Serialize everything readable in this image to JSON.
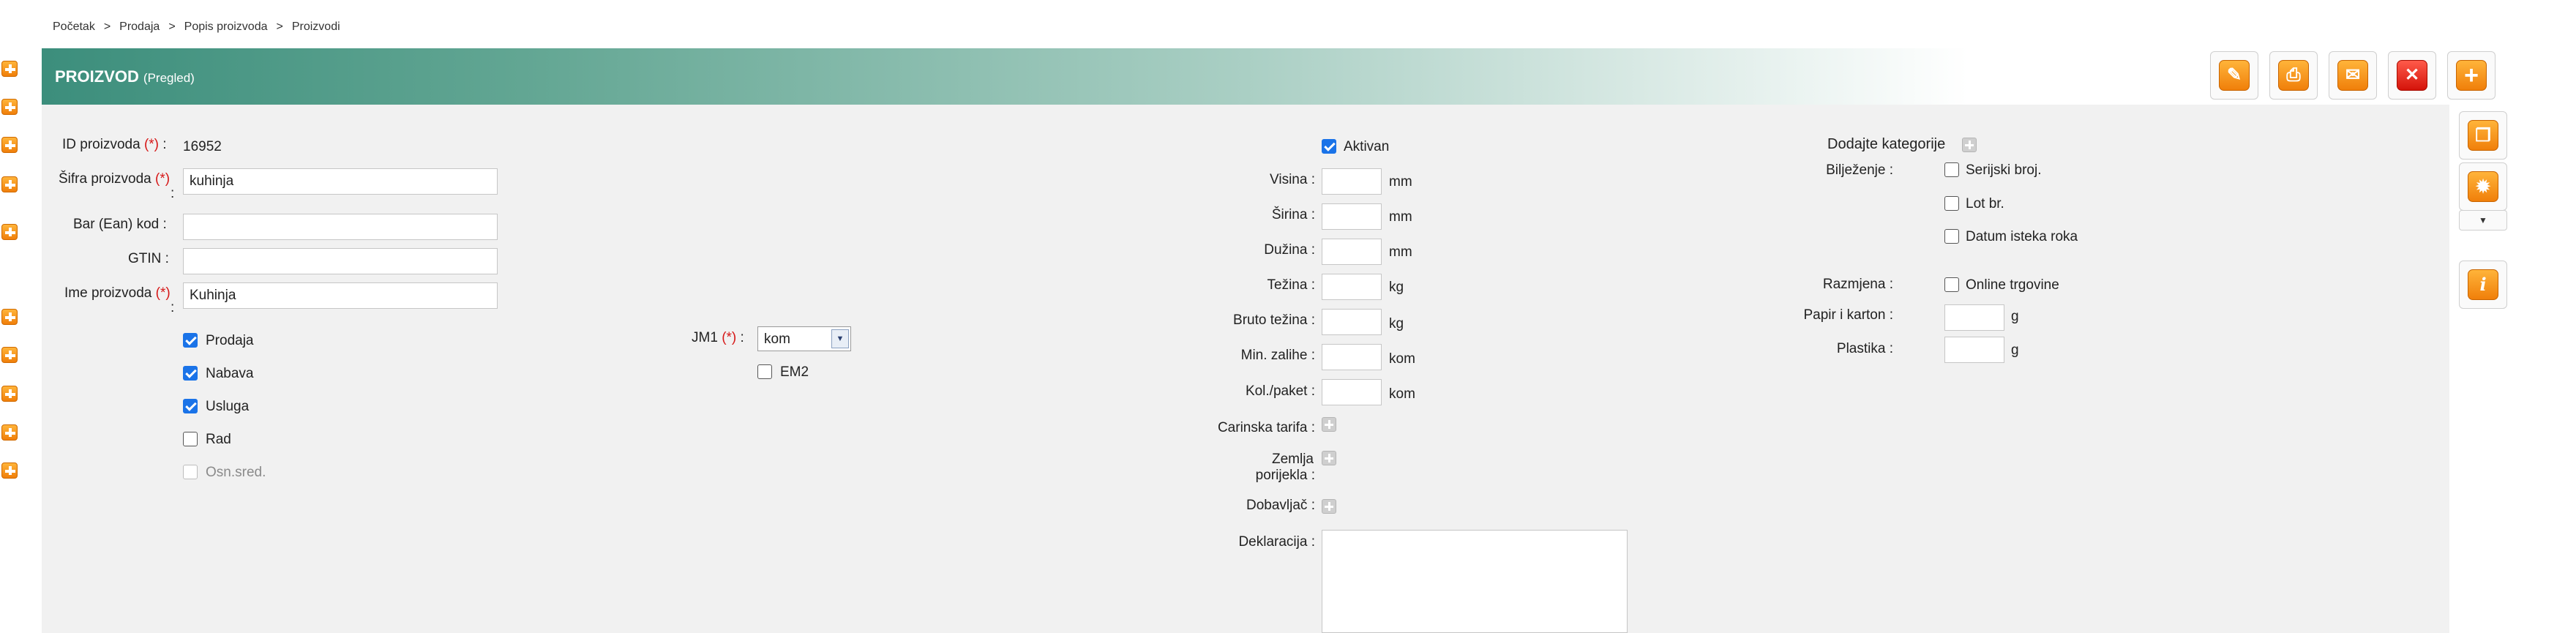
{
  "breadcrumb": [
    "Početak",
    "Prodaja",
    "Popis proizvoda",
    "Proizvodi"
  ],
  "breadcrumb_sep": ">",
  "header": {
    "title": "PROIZVOD",
    "subtitle": "(Pregled)"
  },
  "toolbar": [
    {
      "name": "edit-button",
      "icon": "pencil-icon",
      "glyph": "✎"
    },
    {
      "name": "print-button",
      "icon": "printer-icon",
      "glyph": "⎙"
    },
    {
      "name": "email-button",
      "icon": "envelope-icon",
      "glyph": "✉"
    },
    {
      "name": "delete-button",
      "icon": "close-icon",
      "glyph": "✕"
    },
    {
      "name": "add-button",
      "icon": "plus-icon",
      "glyph": "+"
    }
  ],
  "side_tools": [
    {
      "name": "copy-button",
      "icon": "copy-icon",
      "glyph": "❐"
    },
    {
      "name": "settings-button",
      "icon": "gear-icon",
      "glyph": "✹"
    },
    {
      "name": "info-button",
      "icon": "info-icon",
      "glyph": "i"
    }
  ],
  "side_caret": "▼",
  "required_mark": "(*)",
  "colon": ":",
  "form": {
    "id_label": "ID proizvoda",
    "id_value": "16952",
    "sifra_label": "Šifra proizvoda",
    "sifra_value": "kuhinja",
    "barcode_label": "Bar (Ean) kod",
    "barcode_value": "",
    "gtin_label": "GTIN",
    "gtin_value": "",
    "name_label": "Ime proizvoda",
    "name_value": "Kuhinja",
    "checks": [
      {
        "label": "Prodaja",
        "checked": true
      },
      {
        "label": "Nabava",
        "checked": true
      },
      {
        "label": "Usluga",
        "checked": true
      },
      {
        "label": "Rad",
        "checked": false
      },
      {
        "label": "Osn.sred.",
        "checked": false,
        "disabled": true
      }
    ],
    "jm1_label": "JM1",
    "jm1_value": "kom",
    "em2_label": "EM2",
    "em2_checked": false
  },
  "middle": {
    "aktivan_label": "Aktivan",
    "aktivan_checked": true,
    "fields": [
      {
        "label": "Visina :",
        "unit": "mm",
        "value": ""
      },
      {
        "label": "Širina :",
        "unit": "mm",
        "value": ""
      },
      {
        "label": "Dužina :",
        "unit": "mm",
        "value": ""
      },
      {
        "label": "Težina :",
        "unit": "kg",
        "value": ""
      },
      {
        "label": "Bruto težina :",
        "unit": "kg",
        "value": ""
      },
      {
        "label": "Min. zalihe :",
        "unit": "kom",
        "value": ""
      },
      {
        "label": "Kol./paket :",
        "unit": "kom",
        "value": ""
      }
    ],
    "carinska_label": "Carinska tarifa :",
    "zemlja_label_1": "Zemlja",
    "zemlja_label_2": "porijekla :",
    "dobavljac_label": "Dobavljač :",
    "deklaracija_label": "Deklaracija :"
  },
  "right": {
    "kategorije_label": "Dodajte kategorije",
    "biljezenje_label": "Bilježenje :",
    "biljezenje_options": [
      {
        "label": "Serijski broj.",
        "checked": false
      },
      {
        "label": "Lot br.",
        "checked": false
      },
      {
        "label": "Datum isteka roka",
        "checked": false
      }
    ],
    "razmjena_label": "Razmjena :",
    "online_label": "Online trgovine",
    "online_checked": false,
    "papir_label": "Papir i karton :",
    "papir_unit": "g",
    "plastika_label": "Plastika :",
    "plastika_unit": "g"
  }
}
